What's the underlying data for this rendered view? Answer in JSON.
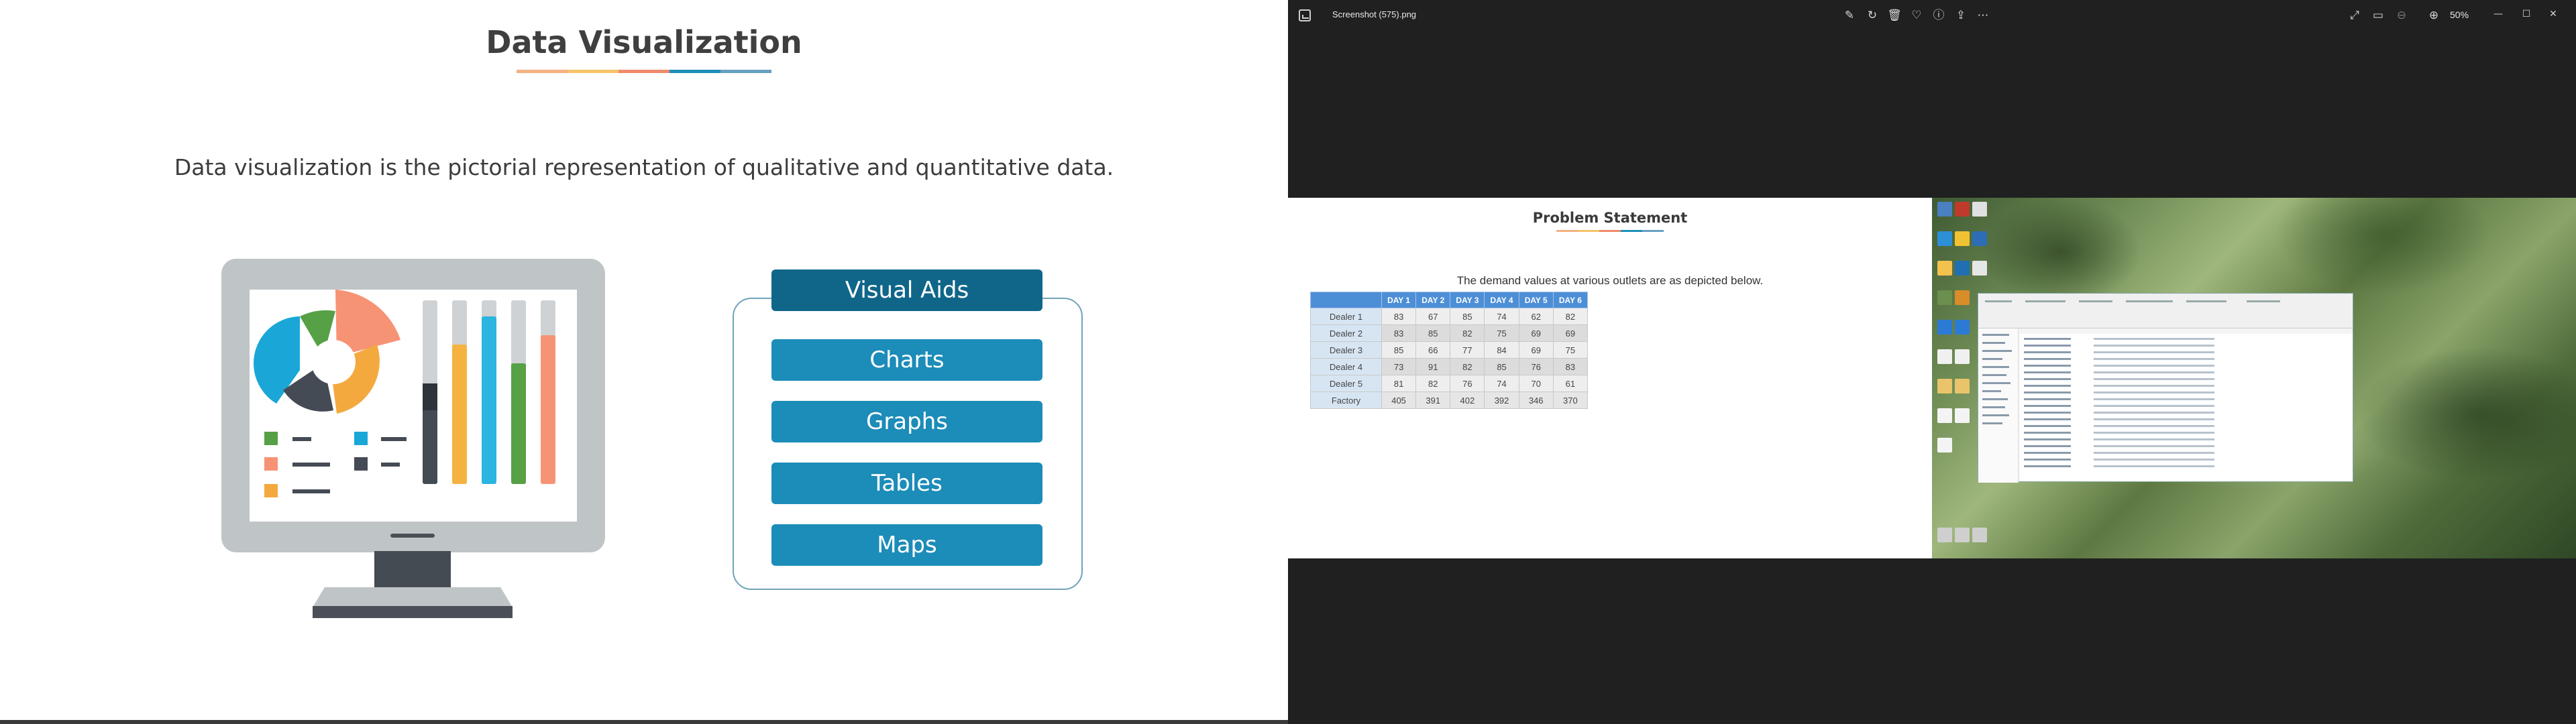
{
  "slide": {
    "title": "Data Visualization",
    "subtitle": "Data visualization is the pictorial representation of qualitative and quantitative data.",
    "underline_colors": [
      "#f4b183",
      "#f6c46a",
      "#f08a6c",
      "#1e8fb8",
      "#66a0c0"
    ],
    "visual_aids": {
      "header": "Visual Aids",
      "items": [
        "Charts",
        "Graphs",
        "Tables",
        "Maps"
      ]
    },
    "colors": {
      "header_bg": "#0f6689",
      "button_bg": "#1c8cb8",
      "pie_colors": [
        "#1aa7d8",
        "#f4a93f",
        "#56a046",
        "#f79375",
        "#454b54"
      ],
      "bar_colors": [
        "#454b54",
        "#f4b23f",
        "#2bb5e0",
        "#56a046",
        "#f79375"
      ]
    }
  },
  "viewer": {
    "file_title": "Screenshot (575).png",
    "zoom": "50%",
    "toolbar_icons": [
      "edit-icon",
      "rotate-icon",
      "delete-icon",
      "favorite-icon",
      "info-icon",
      "share-icon",
      "more-icon"
    ],
    "right_icons": [
      "fullscreen-icon",
      "filmstrip-icon",
      "zoom-out-icon",
      "zoom-in-icon"
    ],
    "window_buttons": [
      "minimize",
      "maximize",
      "close"
    ],
    "image": {
      "title": "Problem Statement",
      "description": "The demand values at various outlets are as depicted below.",
      "table": {
        "headers": [
          "",
          "DAY 1",
          "DAY 2",
          "DAY 3",
          "DAY 4",
          "DAY 5",
          "DAY 6"
        ],
        "rows": [
          [
            "Dealer 1",
            "83",
            "67",
            "85",
            "74",
            "62",
            "82"
          ],
          [
            "Dealer 2",
            "83",
            "85",
            "82",
            "75",
            "69",
            "69"
          ],
          [
            "Dealer 3",
            "85",
            "66",
            "77",
            "84",
            "69",
            "75"
          ],
          [
            "Dealer 4",
            "73",
            "91",
            "82",
            "85",
            "76",
            "83"
          ],
          [
            "Dealer 5",
            "81",
            "82",
            "76",
            "74",
            "70",
            "61"
          ],
          [
            "Factory",
            "405",
            "391",
            "402",
            "392",
            "346",
            "370"
          ]
        ]
      }
    }
  }
}
